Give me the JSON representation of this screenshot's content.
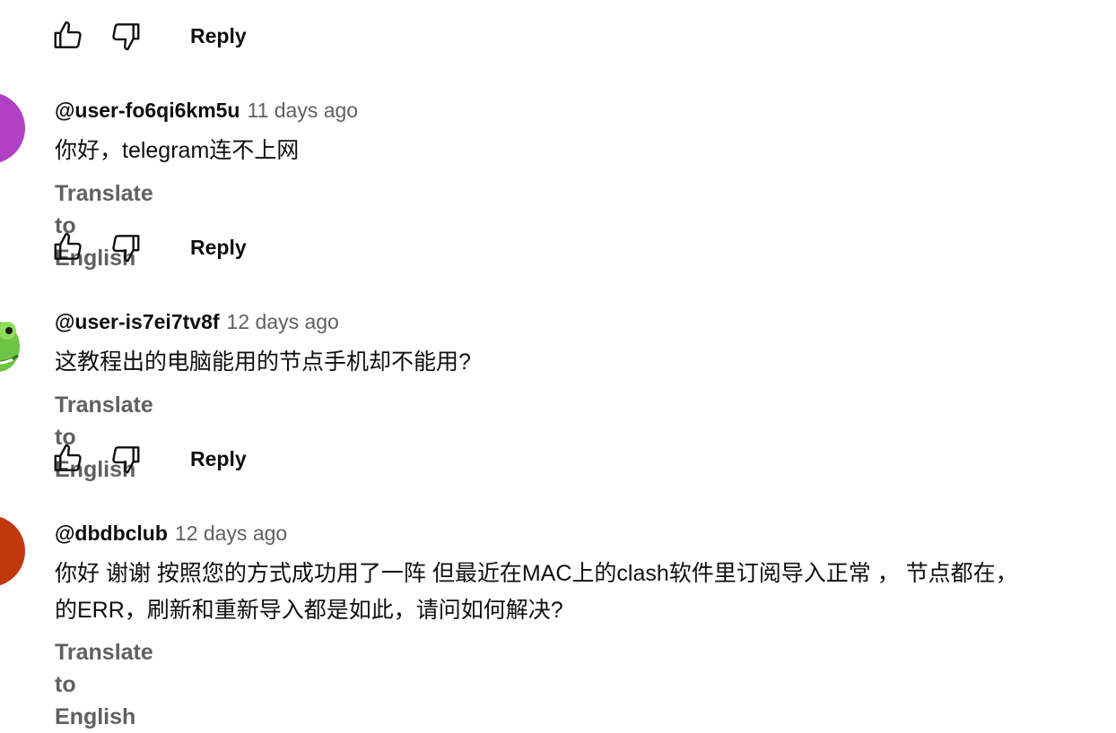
{
  "actions": {
    "reply_label": "Reply"
  },
  "comments": [
    {
      "author": "@user-fo6qi6km5u",
      "time": "11 days ago",
      "lines": [
        "你好，telegram连不上网"
      ],
      "translate": "Translate to English",
      "avatar_color": "#b041c4"
    },
    {
      "author": "@user-is7ei7tv8f",
      "time": "12 days ago",
      "lines": [
        "这教程出的电脑能用的节点手机却不能用?"
      ],
      "translate": "Translate to English",
      "avatar_color": "#5fbf3a"
    },
    {
      "author": "@dbdbclub",
      "time": "12 days ago",
      "lines": [
        "你好 谢谢 按照您的方式成功用了一阵 但最近在MAC上的clash软件里订阅导入正常 ， 节点都在，",
        "的ERR，刷新和重新导入都是如此，请问如何解决?"
      ],
      "translate": "Translate to English",
      "avatar_color": "#c1380f"
    }
  ],
  "icons": {
    "like": "thumbs-up-icon",
    "dislike": "thumbs-down-icon"
  }
}
